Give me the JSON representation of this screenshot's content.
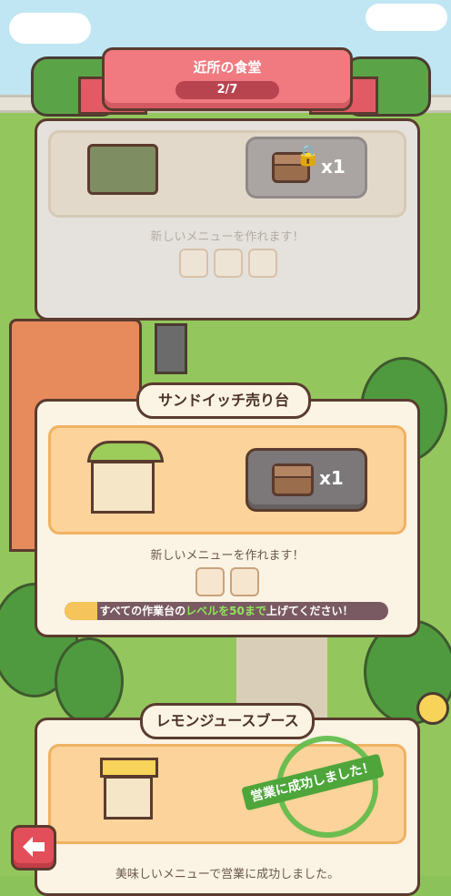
{
  "header": {
    "title": "近所の食堂",
    "page": "2/7"
  },
  "cards": [
    {
      "title": "",
      "state": "locked",
      "reward_count": "x1",
      "description": "新しいメニューを作れます！",
      "menu_icons": [
        "ice-cream-icon",
        "fried-dish-icon",
        "bread-icon"
      ]
    },
    {
      "title": "サンドイッチ売り台",
      "state": "active",
      "reward_count": "x1",
      "description": "新しいメニューを作れます！",
      "menu_icons": [
        "sandwich-icon",
        "meat-dish-icon"
      ],
      "requirement": {
        "prefix": "すべての作業台の",
        "highlight": "レベルを50まで",
        "suffix": "上げてください！",
        "progress": 0.1
      }
    },
    {
      "title": "レモンジュースブース",
      "state": "completed",
      "stamp_text": "営業に成功しました！",
      "description": "美味しいメニューで営業に成功しました。"
    }
  ],
  "colors": {
    "accent": "#f07a80",
    "stamp": "#4ea63b",
    "progress": "#f5c45a",
    "highlight": "#8ee65a"
  },
  "back_button": {
    "icon": "back-arrow-icon"
  }
}
